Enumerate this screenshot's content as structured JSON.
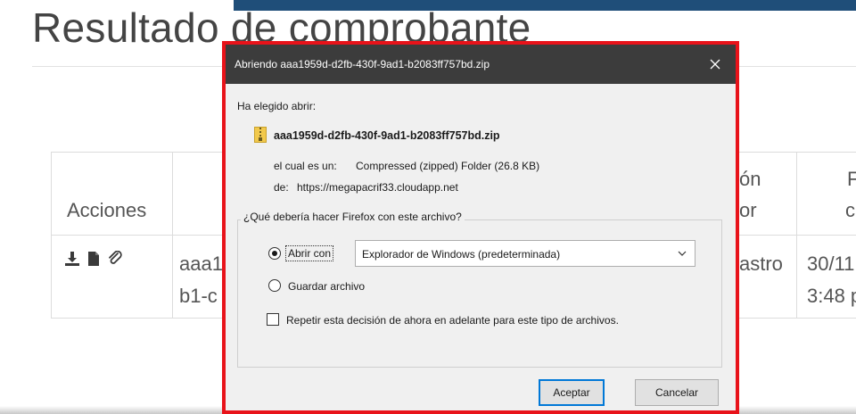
{
  "page": {
    "title": "Resultado de comprobante",
    "table": {
      "col_acciones": "Acciones",
      "col_partial_1_l1": "ón",
      "col_partial_1_l2": "or",
      "col_partial_2_l1": "F",
      "col_partial_2_l2": "c",
      "row_id_l1": "aaa1",
      "row_id_l2": "b1-c",
      "row_status": "astro",
      "row_date_l1": "30/11",
      "row_date_l2": "3:48 p"
    }
  },
  "dialog": {
    "title": "Abriendo aaa1959d-d2fb-430f-9ad1-b2083ff757bd.zip",
    "chosen_label": "Ha elegido abrir:",
    "filename": "aaa1959d-d2fb-430f-9ad1-b2083ff757bd.zip",
    "type_label": "el cual es un:",
    "type_value": "Compressed (zipped) Folder (26.8 KB)",
    "from_label": "de:",
    "from_value": "https://megapacrif33.cloudapp.net",
    "question": "¿Qué debería hacer Firefox con este archivo?",
    "open_with_label": "Abrir con",
    "open_with_selected": true,
    "open_with_app": "Explorador de Windows (predeterminada)",
    "save_label": "Guardar archivo",
    "save_selected": false,
    "remember_label": "Repetir esta decisión de ahora en adelante para este tipo de archivos.",
    "remember_checked": false,
    "ok_label": "Aceptar",
    "cancel_label": "Cancelar"
  },
  "colors": {
    "dialog_border": "#e8131a",
    "titlebar": "#3c3c3c",
    "default_button_border": "#0078d7",
    "top_bar": "#1f4e79"
  },
  "icons": [
    "download-icon",
    "file-icon",
    "paperclip-icon",
    "zip-file-icon",
    "close-icon",
    "chevron-down-icon"
  ]
}
